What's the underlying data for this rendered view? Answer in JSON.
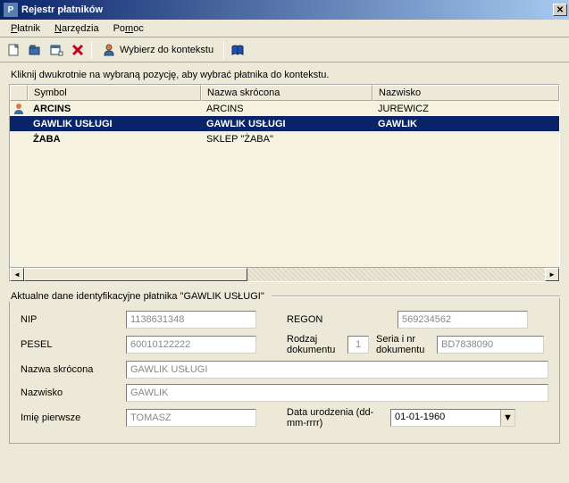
{
  "window": {
    "title": "Rejestr płatników",
    "icon_letter": "P"
  },
  "menu": {
    "items": [
      {
        "label": "Płatnik",
        "hotkey_index": 0
      },
      {
        "label": "Narzędzia",
        "hotkey_index": 0
      },
      {
        "label": "Pomoc",
        "hotkey_index": 2
      }
    ]
  },
  "toolbar": {
    "context_label": "Wybierz do kontekstu"
  },
  "main": {
    "hint": "Kliknij dwukrotnie na wybraną pozycję, aby wybrać płatnika do kontekstu.",
    "columns": [
      "Symbol",
      "Nazwa skrócona",
      "Nazwisko"
    ],
    "rows": [
      {
        "symbol": "ARCINS",
        "nazwa": "ARCINS",
        "nazwisko": "JUREWICZ",
        "selected": false,
        "icon": true
      },
      {
        "symbol": "GAWLIK USŁUGI",
        "nazwa": "GAWLIK USŁUGI",
        "nazwisko": "GAWLIK",
        "selected": true,
        "icon": false
      },
      {
        "symbol": "ŻABA",
        "nazwa": "SKLEP \"ŻABA\"",
        "nazwisko": "",
        "selected": false,
        "icon": false
      }
    ]
  },
  "details": {
    "title": "Aktualne dane identyfikacyjne płatnika \"GAWLIK USŁUGI\"",
    "labels": {
      "nip": "NIP",
      "regon": "REGON",
      "pesel": "PESEL",
      "rodzaj_dok": "Rodzaj dokumentu",
      "seria_nr": "Seria i nr dokumentu",
      "nazwa_skr": "Nazwa skrócona",
      "nazwisko": "Nazwisko",
      "imie": "Imię pierwsze",
      "data_ur": "Data urodzenia (dd-mm-rrrr)"
    },
    "values": {
      "nip": "1138631348",
      "regon": "569234562",
      "pesel": "60010122222",
      "rodzaj_dok": "1",
      "seria_nr": "BD7838090",
      "nazwa_skr": "GAWLIK USŁUGI",
      "nazwisko": "GAWLIK",
      "imie": "TOMASZ",
      "data_ur": "01-01-1960"
    }
  }
}
